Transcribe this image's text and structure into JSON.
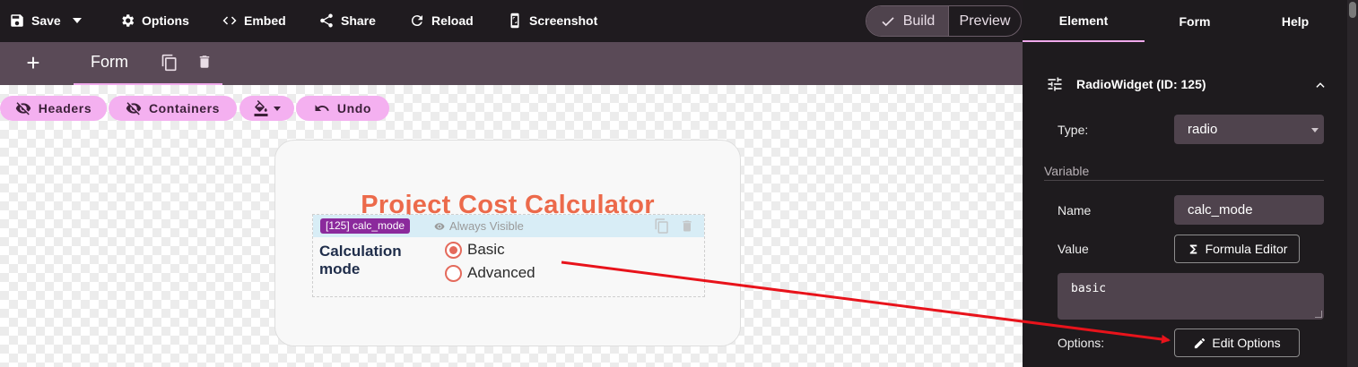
{
  "toolbar": {
    "save": "Save",
    "options": "Options",
    "embed": "Embed",
    "share": "Share",
    "reload": "Reload",
    "screenshot": "Screenshot",
    "build": "Build",
    "preview": "Preview"
  },
  "tabs": {
    "add": "+",
    "form": "Form"
  },
  "canvas_toolbar": {
    "headers": "Headers",
    "containers": "Containers",
    "undo": "Undo"
  },
  "form": {
    "title": "Project Cost Calculator",
    "widget": {
      "badge": "[125] calc_mode",
      "visibility": "Always Visible",
      "label": "Calculation mode",
      "options": [
        {
          "label": "Basic",
          "selected": true
        },
        {
          "label": "Advanced",
          "selected": false
        }
      ]
    }
  },
  "panel": {
    "tabs": [
      "Element",
      "Form",
      "Help"
    ],
    "active_tab": "Element",
    "section_title": "RadioWidget (ID: 125)",
    "type_label": "Type:",
    "type_value": "radio",
    "variable_heading": "Variable",
    "name_label": "Name",
    "name_value": "calc_mode",
    "value_label": "Value",
    "formula_button": "Formula Editor",
    "value_text": "basic",
    "options_label": "Options:",
    "edit_options_button": "Edit Options"
  },
  "colors": {
    "accent_pink": "#f4b0f0",
    "title_orange": "#ec6a4b",
    "badge_purple": "#8b2a9c",
    "arrow_red": "#e8131b"
  }
}
